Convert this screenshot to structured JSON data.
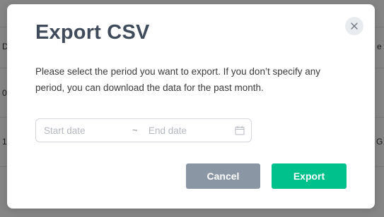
{
  "backdrop": {
    "row_chars": [
      "D",
      "0",
      "1"
    ],
    "right_chars": [
      "e",
      "G"
    ]
  },
  "dialog": {
    "title": "Export CSV",
    "close_icon": "close-icon",
    "description": "Please select the period you want to export. If you don’t specify any period, you can download the data for the past month.",
    "date_range": {
      "start_placeholder": "Start date",
      "end_placeholder": "End date",
      "separator": "~",
      "start_value": "",
      "end_value": "",
      "calendar_icon": "calendar-icon"
    },
    "buttons": {
      "cancel_label": "Cancel",
      "export_label": "Export"
    }
  },
  "colors": {
    "title": "#3f4a5b",
    "cancel_bg": "#8a96a3",
    "export_bg": "#00c08b",
    "close_bg": "#e9ecef"
  }
}
